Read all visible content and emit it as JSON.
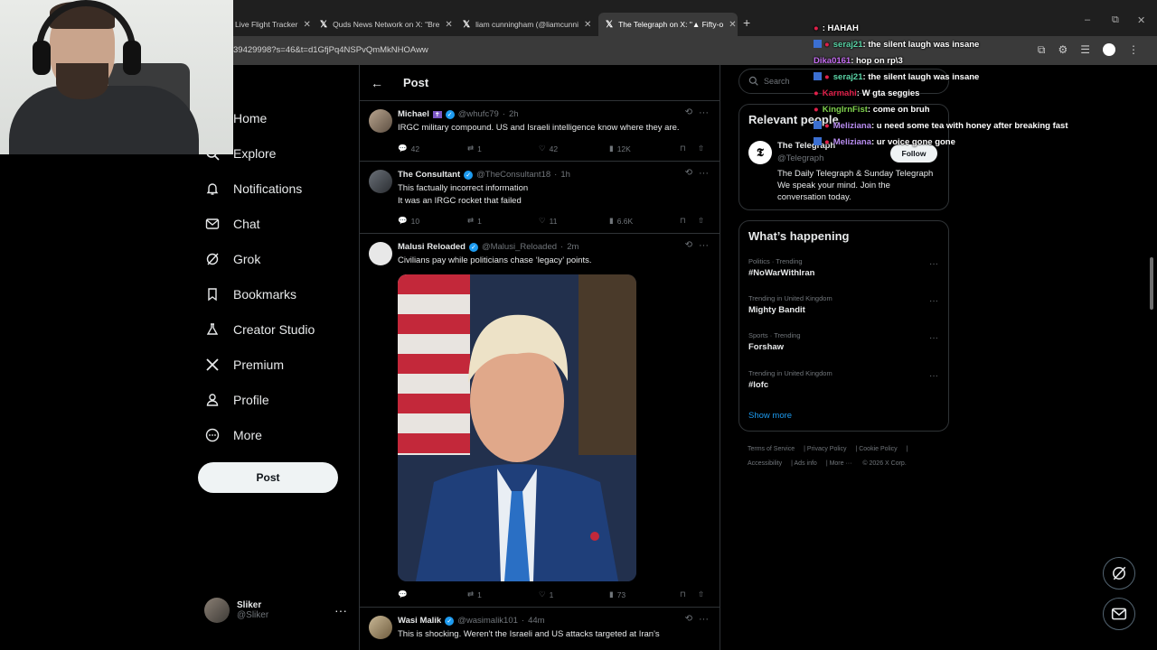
{
  "browser": {
    "tabs": [
      {
        "title": "Live Flight Tracker",
        "active": false
      },
      {
        "title": "Quds News Network on X: \"Bre",
        "active": false
      },
      {
        "title": "liam cunningham (@liamcunni",
        "active": false
      },
      {
        "title": "The Telegraph on X: \"▲ Fifty-o",
        "active": true
      }
    ],
    "url": "39429998?s=46&t=d1GfjPq4NSPvQmMkNHOAww",
    "new_tab": "+",
    "window_controls": [
      "–",
      "⧉",
      "✕"
    ]
  },
  "nav": {
    "items": [
      {
        "label": "Home",
        "icon": "home-icon"
      },
      {
        "label": "Explore",
        "icon": "search-icon"
      },
      {
        "label": "Notifications",
        "icon": "bell-icon"
      },
      {
        "label": "Chat",
        "icon": "mail-icon"
      },
      {
        "label": "Grok",
        "icon": "grok-icon"
      },
      {
        "label": "Bookmarks",
        "icon": "bookmark-icon"
      },
      {
        "label": "Creator Studio",
        "icon": "flask-icon"
      },
      {
        "label": "Premium",
        "icon": "x-logo-icon"
      },
      {
        "label": "Profile",
        "icon": "person-icon"
      },
      {
        "label": "More",
        "icon": "more-circle-icon"
      }
    ],
    "post_button": "Post",
    "account": {
      "name": "Sliker",
      "handle": "@Sliker"
    }
  },
  "main": {
    "header_title": "Post",
    "tweets": [
      {
        "name": "Michael",
        "badge": "✝",
        "verified": true,
        "handle": "@whufc79",
        "time": "2h",
        "text": [
          "IRGC military compound. US and Israeli intelligence know where they are."
        ],
        "replies": "42",
        "retweets": "1",
        "likes": "42",
        "views": "12K"
      },
      {
        "name": "The Consultant",
        "verified": true,
        "handle": "@TheConsultant18",
        "time": "1h",
        "text": [
          "This factually incorrect information",
          "It was an IRGC rocket that failed"
        ],
        "replies": "10",
        "retweets": "1",
        "likes": "11",
        "views": "6.6K"
      },
      {
        "name": "Malusi Reloaded",
        "verified": true,
        "handle": "@Malusi_Reloaded",
        "time": "2m",
        "text": [
          "Civilians pay while politicians chase ‘legacy’ points."
        ],
        "replies": "",
        "retweets": "1",
        "likes": "1",
        "views": "73"
      },
      {
        "name": "Wasi Malik",
        "verified": true,
        "handle": "@wasimalik101",
        "time": "44m",
        "text": [
          "This is shocking. Weren't the Israeli and US attacks targeted at Iran's"
        ]
      }
    ]
  },
  "sidebar": {
    "search_placeholder": "Search",
    "relevant_title": "Relevant people",
    "relevant": {
      "name": "The Telegraph",
      "handle": "@Telegraph",
      "bio": "The Daily Telegraph & Sunday Telegraph We speak your mind. Join the conversation today.",
      "follow": "Follow"
    },
    "happening_title": "What’s happening",
    "trends": [
      {
        "context": "Politics · Trending",
        "topic": "#NoWarWithIran"
      },
      {
        "context": "Trending in United Kingdom",
        "topic": "Mighty Bandit"
      },
      {
        "context": "Sports · Trending",
        "topic": "Forshaw"
      },
      {
        "context": "Trending in United Kingdom",
        "topic": "#lofc"
      }
    ],
    "show_more": "Show more",
    "footer": [
      "Terms of Service",
      "Privacy Policy",
      "Cookie Policy",
      "Accessibility",
      "Ads info",
      "More ···",
      "© 2026 X Corp."
    ]
  },
  "chat": [
    {
      "user": "",
      "msg": ": HAHAH",
      "color": "#e0204a"
    },
    {
      "user": "seraj21",
      "msg": ": the silent laugh was insane",
      "color": "#5ad4a6"
    },
    {
      "user": "Dika0161",
      "msg": ": hop on rp\\3",
      "color": "#c46cf0"
    },
    {
      "user": "seraj21",
      "msg": ": the silent laugh was insane",
      "color": "#5ad4a6"
    },
    {
      "user": "Karmahi",
      "msg": ": W gta seggies",
      "color": "#e0204a"
    },
    {
      "user": "KingIrnFist",
      "msg": ": come on bruh",
      "color": "#7fd14d"
    },
    {
      "user": "Meliziana",
      "msg": ": u need some tea with honey after breaking fast",
      "color": "#b88cf0"
    },
    {
      "user": "Meliziana",
      "msg": ": ur voice gone gone",
      "color": "#b88cf0"
    }
  ],
  "colors": {
    "accent": "#1d9bf0",
    "background": "#000000",
    "border": "#2f3336",
    "muted": "#71767b"
  }
}
